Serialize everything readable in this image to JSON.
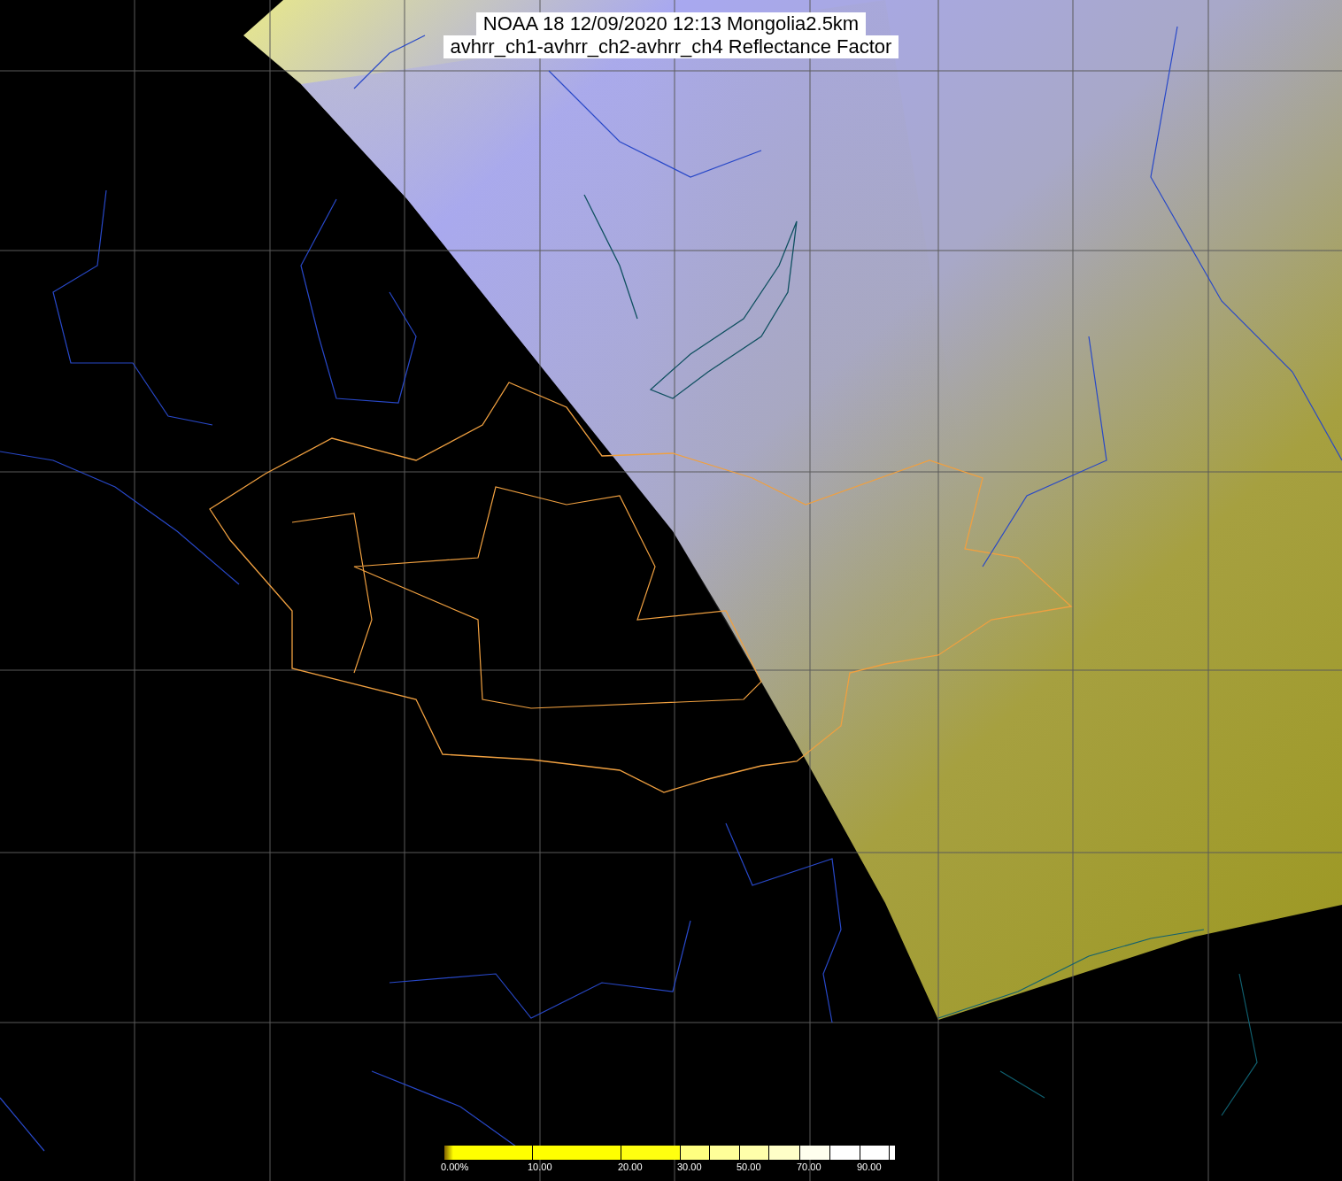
{
  "title": {
    "lines": [
      "NOAA 18 12/09/2020 12:13 Mongolia2.5km",
      "avhrr_ch1-avhrr_ch2-avhrr_ch4 Reflectance Factor"
    ]
  },
  "colorbar": {
    "labels": [
      "0.00%",
      "10.00",
      "20.00",
      "30.00",
      "50.00",
      "70.00",
      "90.00"
    ]
  }
}
